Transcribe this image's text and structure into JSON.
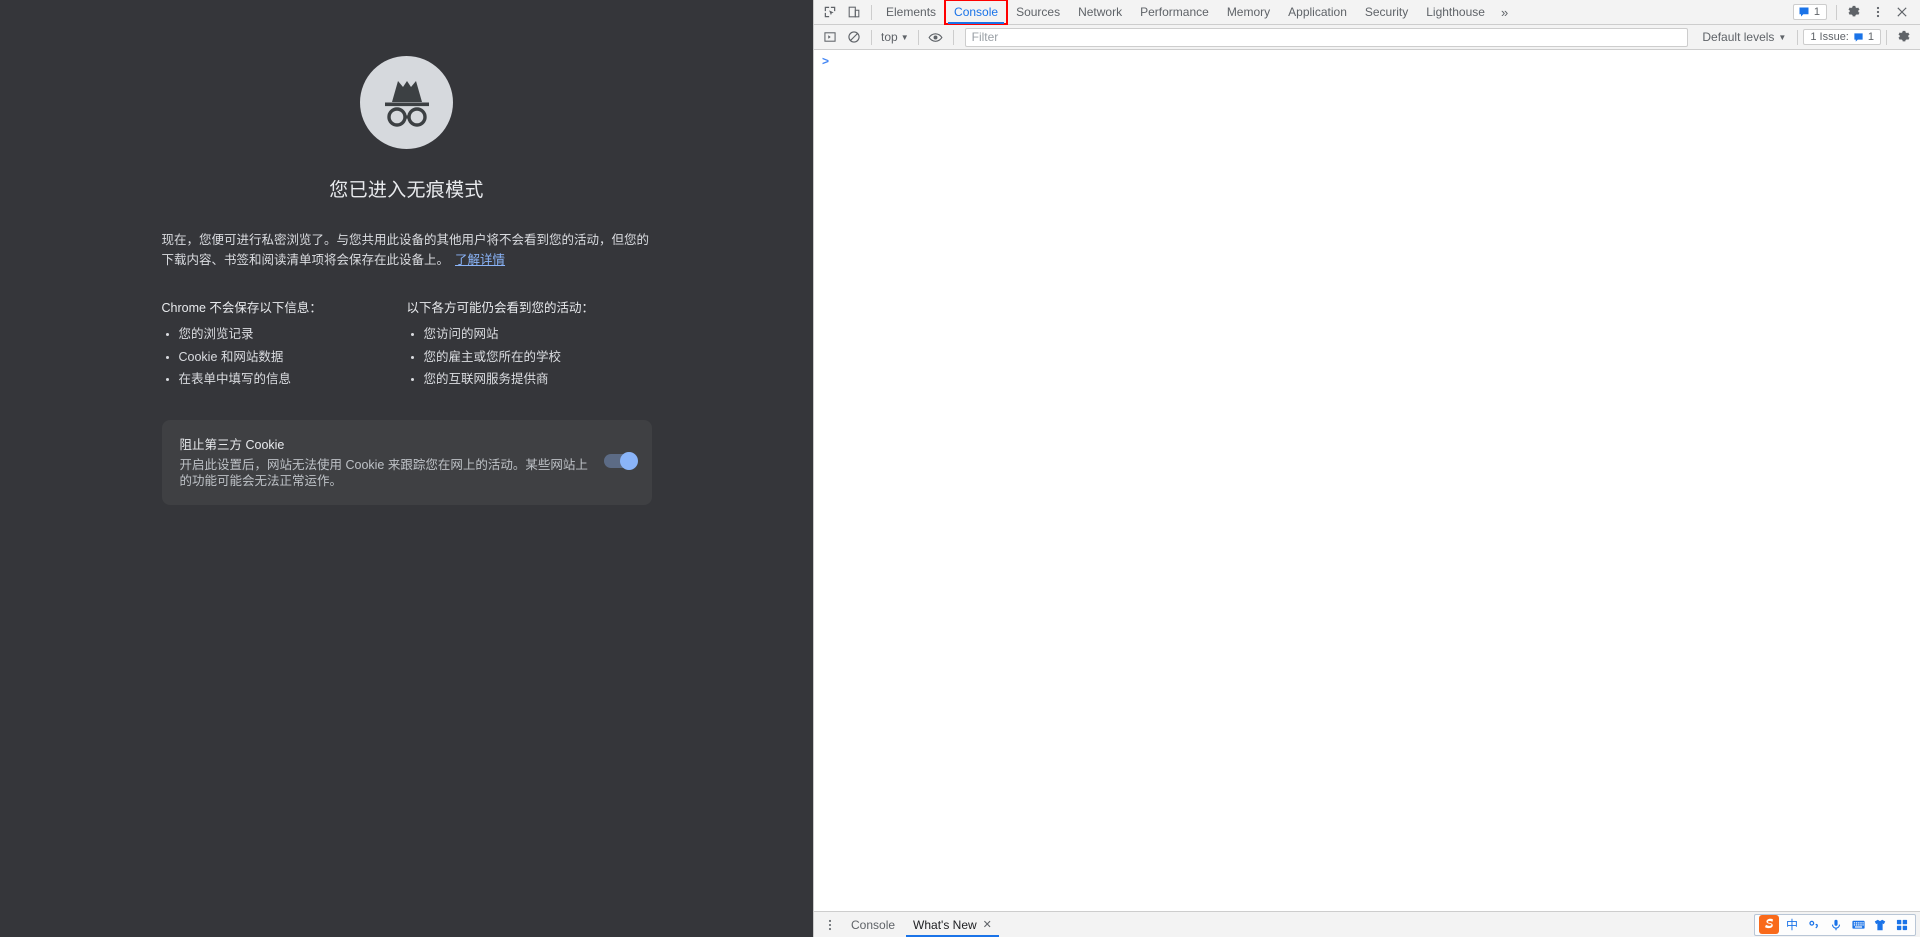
{
  "incognito": {
    "icon_name": "incognito-icon",
    "title": "您已进入无痕模式",
    "description": "现在，您便可进行私密浏览了。与您共用此设备的其他用户将不会看到您的活动，但您的下载内容、书签和阅读清单项将会保存在此设备上。",
    "learn_more": "了解详情",
    "columns": [
      {
        "heading": "Chrome 不会保存以下信息：",
        "items": [
          "您的浏览记录",
          "Cookie 和网站数据",
          "在表单中填写的信息"
        ]
      },
      {
        "heading": "以下各方可能仍会看到您的活动：",
        "items": [
          "您访问的网站",
          "您的雇主或您所在的学校",
          "您的互联网服务提供商"
        ]
      }
    ],
    "cookie_card": {
      "title": "阻止第三方 Cookie",
      "description": "开启此设置后，网站无法使用 Cookie 来跟踪您在网上的活动。某些网站上的功能可能会无法正常运作。",
      "toggle_state": "on"
    },
    "colors": {
      "background": "#35363a",
      "card": "#3f4043",
      "link": "#8ab4f8",
      "toggle_on": "#8ab4f8"
    }
  },
  "devtools": {
    "tabs": [
      {
        "label": "Elements",
        "selected": false,
        "highlighted": false
      },
      {
        "label": "Console",
        "selected": true,
        "highlighted": true
      },
      {
        "label": "Sources",
        "selected": false,
        "highlighted": false
      },
      {
        "label": "Network",
        "selected": false,
        "highlighted": false
      },
      {
        "label": "Performance",
        "selected": false,
        "highlighted": false
      },
      {
        "label": "Memory",
        "selected": false,
        "highlighted": false
      },
      {
        "label": "Application",
        "selected": false,
        "highlighted": false
      },
      {
        "label": "Security",
        "selected": false,
        "highlighted": false
      },
      {
        "label": "Lighthouse",
        "selected": false,
        "highlighted": false
      }
    ],
    "more_tabs_label": "»",
    "inspect_icon": "inspect-element-icon",
    "device_toolbar_icon": "device-toolbar-icon",
    "issues_count": "1",
    "settings_icon": "gear-icon",
    "more_options_icon": "kebab-menu-icon",
    "close_icon": "close-icon",
    "console_toolbar": {
      "sidebar_toggle_icon": "console-sidebar-icon",
      "clear_console_icon": "clear-console-icon",
      "context_label": "top",
      "eye_icon": "live-expression-icon",
      "filter_placeholder": "Filter",
      "filter_value": "",
      "levels_label": "Default levels",
      "issues_label": "1 Issue:",
      "issues_count": "1",
      "console_settings_icon": "gear-icon"
    },
    "console_prompt": ">",
    "drawer": {
      "more_icon": "kebab-menu-icon",
      "tabs": [
        {
          "label": "Console",
          "selected": false,
          "closable": false
        },
        {
          "label": "What's New",
          "selected": true,
          "closable": true
        }
      ],
      "close_label": "✕"
    },
    "accent_color": "#1a73e8",
    "highlight_color": "#ff0000"
  },
  "ime_tray": {
    "logo_name": "sogou-logo-icon",
    "items": [
      {
        "name": "chinese-mode-icon",
        "glyph": "中"
      },
      {
        "name": "punctuation-mode-icon",
        "glyph": "°,"
      },
      {
        "name": "voice-input-icon",
        "glyph": "🎤"
      },
      {
        "name": "soft-keyboard-icon",
        "glyph": "⌨"
      },
      {
        "name": "skin-icon",
        "glyph": "👕"
      },
      {
        "name": "toolbox-icon",
        "glyph": "▦"
      }
    ]
  }
}
